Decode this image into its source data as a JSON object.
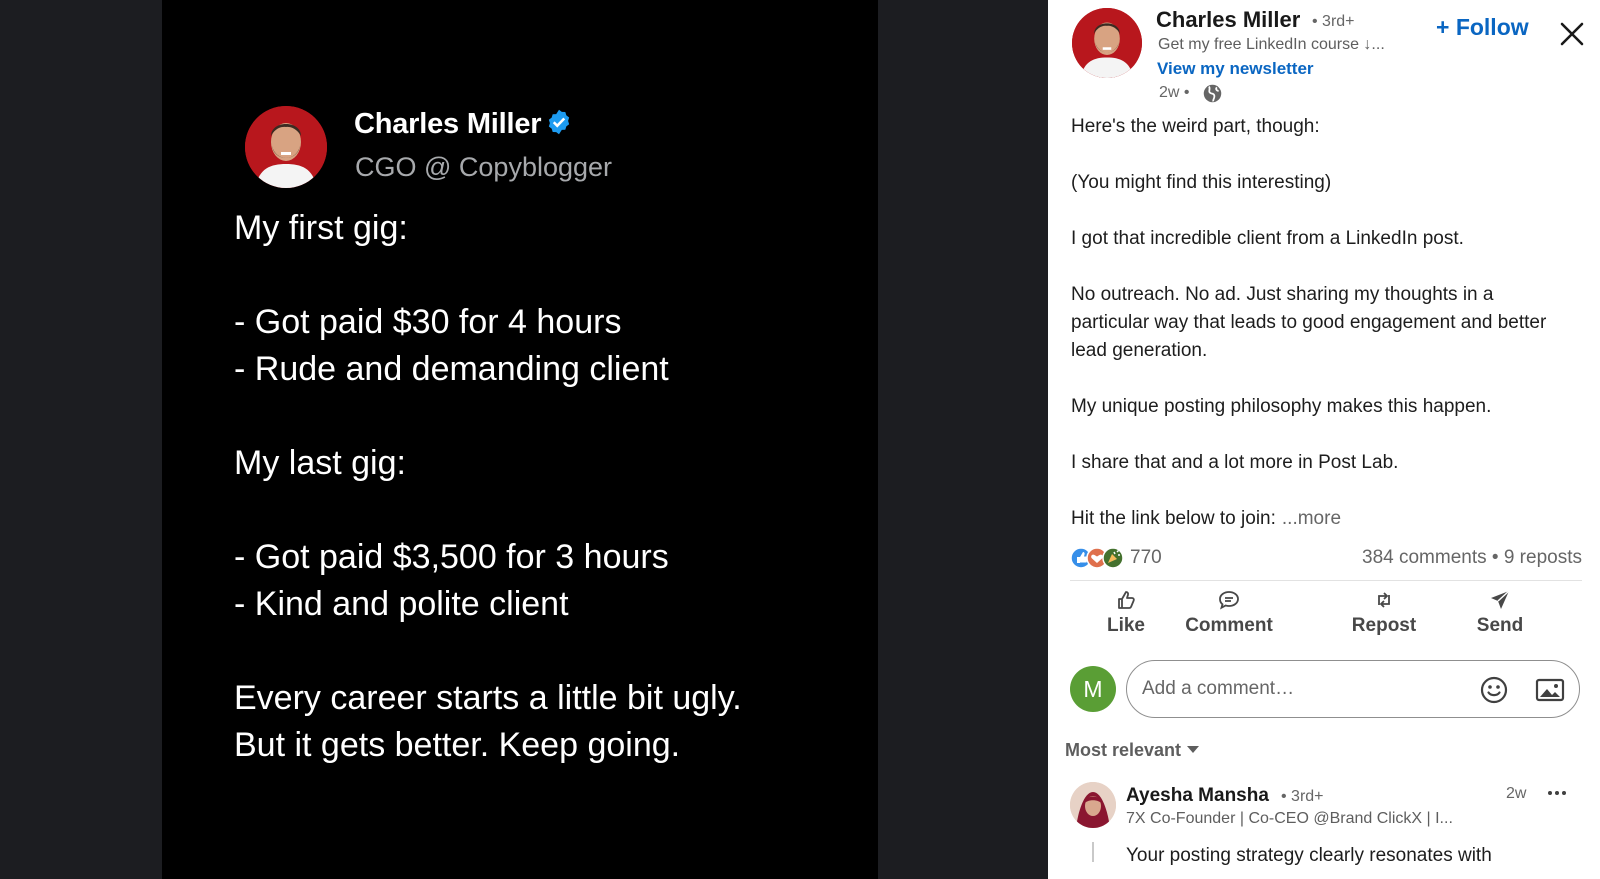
{
  "media": {
    "author_name": "Charles Miller",
    "author_handle": "CGO @ Copyblogger",
    "tweet_lines": [
      "My first gig:",
      "",
      "- Got paid $30 for 4 hours",
      "- Rude and demanding client",
      "",
      "My last gig:",
      "",
      "- Got paid $3,500 for 3 hours",
      "- Kind and polite client",
      "",
      "Every career starts a little bit ugly.",
      "But it gets better. Keep going."
    ]
  },
  "author": {
    "name": "Charles Miller",
    "degree": "• 3rd+",
    "headline": "Get my free LinkedIn course ↓...",
    "newsletter_link": "View my newsletter",
    "time": "2w •",
    "follow_label": "+ Follow"
  },
  "post": {
    "paragraphs": [
      "Here's the weird part, though:",
      "(You might find this interesting)",
      "I got that incredible client from a LinkedIn post.",
      "No outreach. No ad. Just sharing my thoughts in a particular way that leads to good engagement and better lead generation.",
      "My unique posting philosophy makes this happen.",
      "I share that and a lot more in Post Lab."
    ],
    "last_line": "Hit the link below to join:",
    "see_more": "...more"
  },
  "social": {
    "reaction_count": "770",
    "engagement": "384 comments • 9 reposts",
    "reaction_icons": [
      "like-icon",
      "love-icon",
      "celebrate-icon"
    ]
  },
  "actions": {
    "like": "Like",
    "comment": "Comment",
    "repost": "Repost",
    "send": "Send"
  },
  "comment_box": {
    "avatar_letter": "M",
    "placeholder": "Add a comment…"
  },
  "comments": {
    "sort_label": "Most relevant",
    "first": {
      "name": "Ayesha Mansha",
      "degree": "• 3rd+",
      "headline": "7X Co-Founder | Co-CEO @Brand ClickX | I...",
      "time": "2w",
      "snippet": "Your posting strategy clearly resonates with"
    }
  },
  "colors": {
    "accent": "#0a66c2",
    "media_bg": "#000000",
    "viewer_bg": "#1c1d21",
    "avatar_red": "#b8171d",
    "me_avatar_green": "#5a9e35"
  }
}
